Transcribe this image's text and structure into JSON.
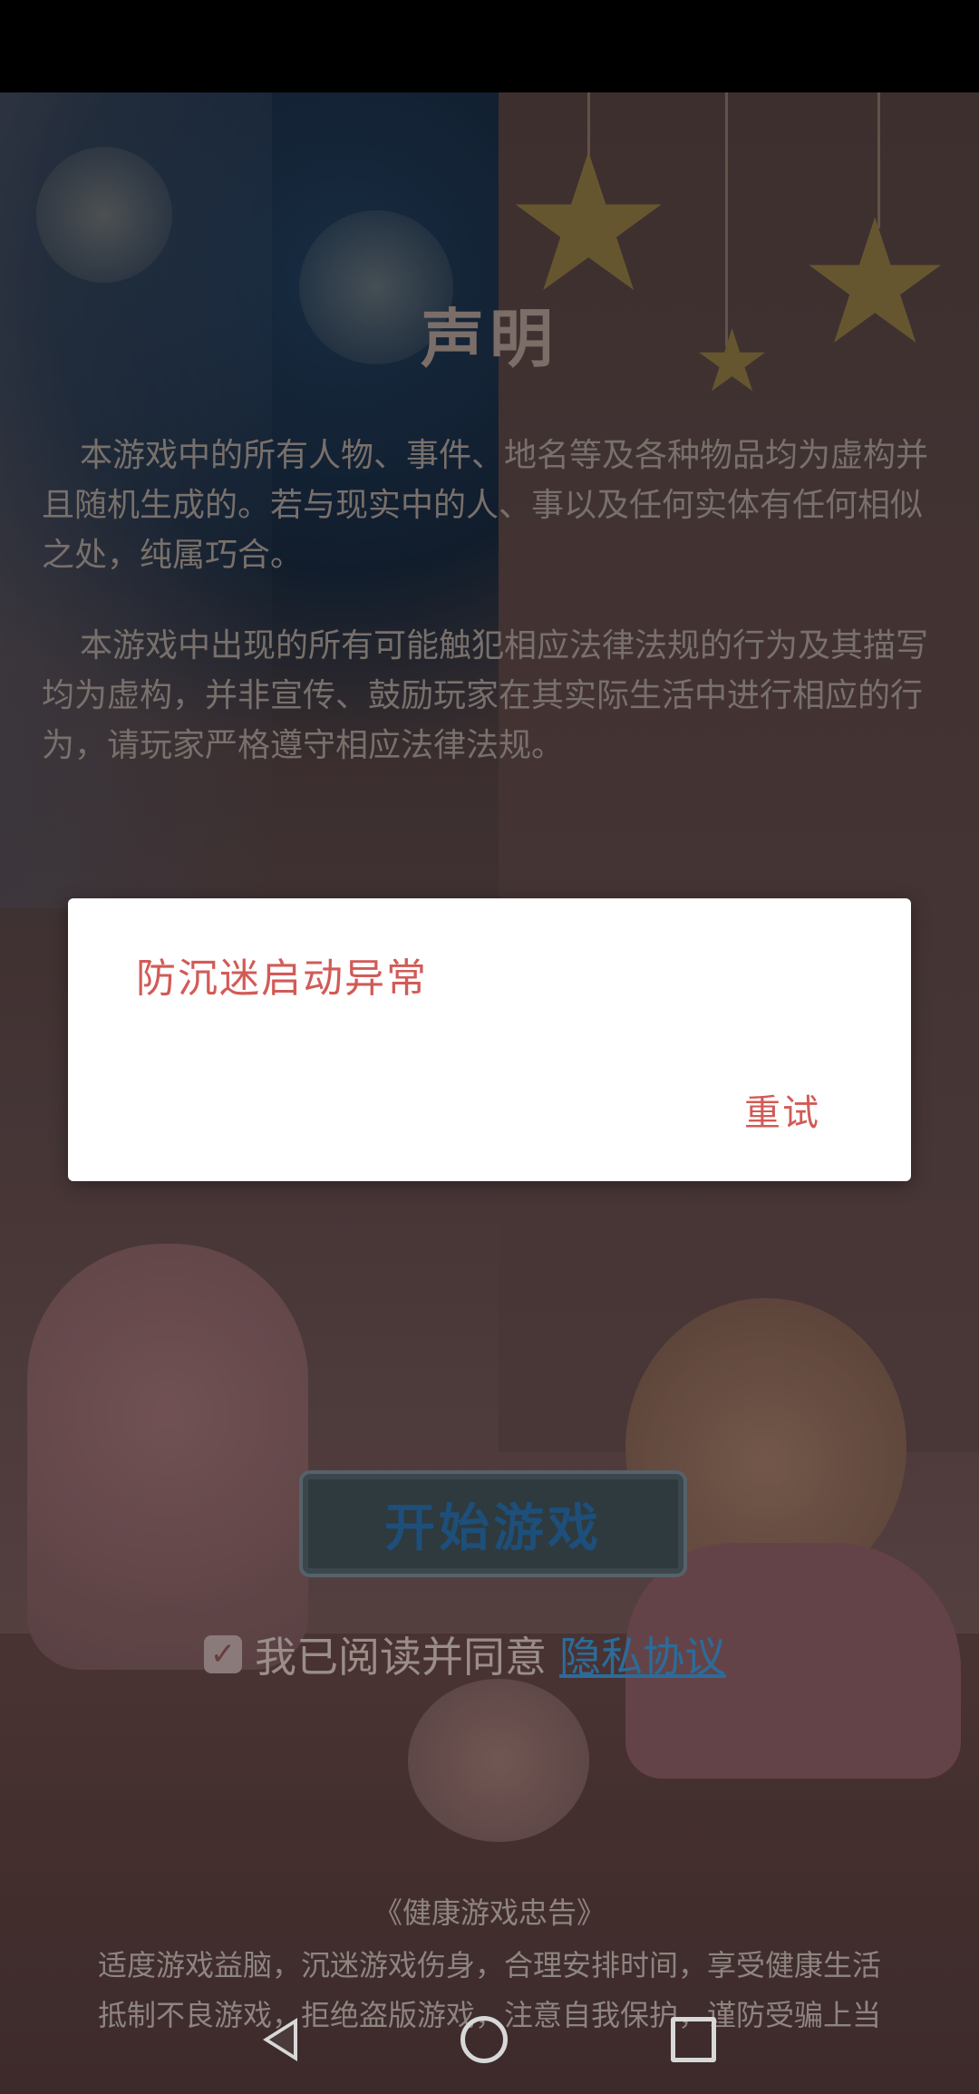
{
  "declaration": {
    "title": "声明",
    "paragraph_1": "本游戏中的所有人物、事件、地名等及各种物品均为虚构并且随机生成的。若与现实中的人、事以及任何实体有任何相似之处，纯属巧合。",
    "paragraph_2": "本游戏中出现的所有可能触犯相应法律法规的行为及其描写均为虚构，并非宣传、鼓励玩家在其实际生活中进行相应的行为，请玩家严格遵守相应法律法规。"
  },
  "start_button_label": "开始游戏",
  "agreement": {
    "text": "我已阅读并同意",
    "link": "隐私协议",
    "checked": true
  },
  "health_advice": {
    "title": "《健康游戏忠告》",
    "line_1": "适度游戏益脑，沉迷游戏伤身，合理安排时间，享受健康生活",
    "line_2": "抵制不良游戏，拒绝盗版游戏，注意自我保护，谨防受骗上当"
  },
  "dialog": {
    "message": "防沉迷启动异常",
    "retry_label": "重试"
  },
  "nav_bar": {
    "icons": [
      "back-icon",
      "home-icon",
      "recent-apps-icon"
    ]
  },
  "colors": {
    "dialog_text": "#d25b57",
    "link": "#2b6c9a"
  }
}
